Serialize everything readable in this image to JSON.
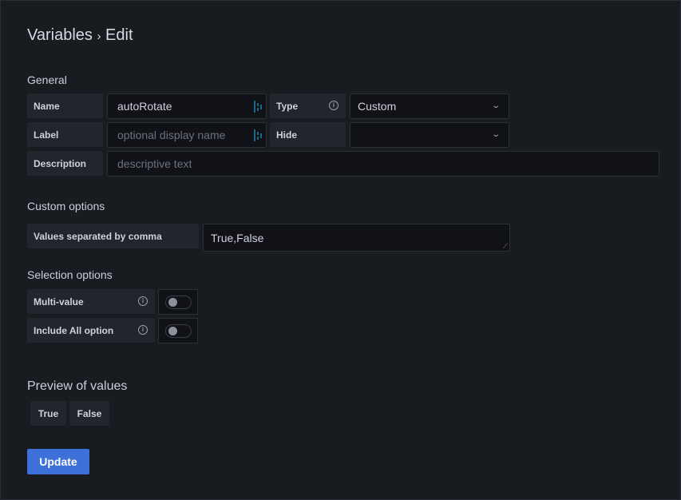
{
  "header": {
    "title": "Variables",
    "separator": "›",
    "subtitle": "Edit"
  },
  "general": {
    "heading": "General",
    "name_label": "Name",
    "name_value": "autoRotate",
    "type_label": "Type",
    "type_value": "Custom",
    "label_label": "Label",
    "label_placeholder": "optional display name",
    "hide_label": "Hide",
    "hide_value": "",
    "description_label": "Description",
    "description_placeholder": "descriptive text"
  },
  "custom": {
    "heading": "Custom options",
    "values_label": "Values separated by comma",
    "values_value": "True,False"
  },
  "selection": {
    "heading": "Selection options",
    "multi_label": "Multi-value",
    "multi_on": false,
    "include_all_label": "Include All option",
    "include_all_on": false
  },
  "preview": {
    "heading": "Preview of values",
    "values": [
      "True",
      "False"
    ]
  },
  "actions": {
    "update_label": "Update"
  },
  "colors": {
    "accent": "#3d71d9",
    "background": "#181b1f",
    "variable_icon": "#18688a"
  }
}
